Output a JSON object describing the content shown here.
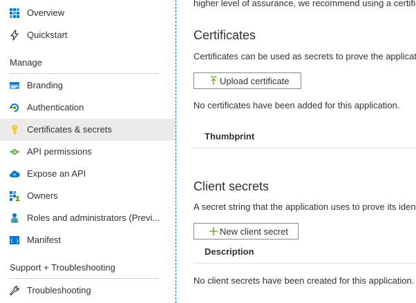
{
  "sidebar": {
    "items_top": [
      {
        "label": "Overview",
        "icon": "overview-grid-icon"
      },
      {
        "label": "Quickstart",
        "icon": "quickstart-icon"
      }
    ],
    "manage_header": "Manage",
    "manage_items": [
      {
        "label": "Branding",
        "icon": "branding-icon"
      },
      {
        "label": "Authentication",
        "icon": "authentication-icon"
      },
      {
        "label": "Certificates & secrets",
        "icon": "key-icon",
        "selected": true
      },
      {
        "label": "API permissions",
        "icon": "api-permissions-icon"
      },
      {
        "label": "Expose an API",
        "icon": "cloud-icon"
      },
      {
        "label": "Owners",
        "icon": "owners-icon"
      },
      {
        "label": "Roles and administrators (Previ...",
        "icon": "roles-icon"
      },
      {
        "label": "Manifest",
        "icon": "manifest-icon"
      }
    ],
    "support_header": "Support + Troubleshooting",
    "support_items": [
      {
        "label": "Troubleshooting",
        "icon": "wrench-icon"
      }
    ]
  },
  "main": {
    "intro_text": "higher level of assurance, we recommend using a certificate",
    "certificates": {
      "title": "Certificates",
      "description": "Certificates can be used as secrets to prove the application's identity",
      "upload_button": "Upload certificate",
      "empty_text": "No certificates have been added for this application.",
      "column_header": "Thumbprint"
    },
    "client_secrets": {
      "title": "Client secrets",
      "description": "A secret string that the application uses to prove its identity",
      "new_button": "New client secret",
      "column_header": "Description",
      "empty_text": "No client secrets have been created for this application."
    }
  },
  "colors": {
    "accent": "#0078d4",
    "selected_bg": "#edebe9",
    "icon_green": "#57a300",
    "key_yellow": "#f2c811"
  }
}
